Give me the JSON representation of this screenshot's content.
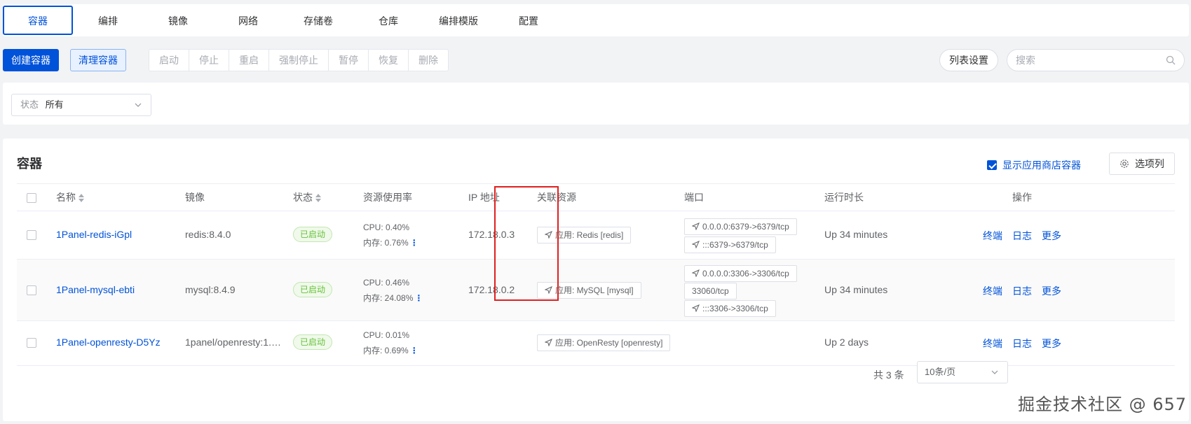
{
  "tabs": [
    "容器",
    "编排",
    "镜像",
    "网络",
    "存储卷",
    "仓库",
    "编排模版",
    "配置"
  ],
  "toolbar": {
    "create": "创建容器",
    "prune": "清理容器",
    "actions": [
      "启动",
      "停止",
      "重启",
      "强制停止",
      "暂停",
      "恢复",
      "删除"
    ],
    "list_settings": "列表设置",
    "search_placeholder": "搜索"
  },
  "filter": {
    "label": "状态",
    "value": "所有"
  },
  "main": {
    "title": "容器",
    "show_store": "显示应用商店容器",
    "columns_button": "选项列"
  },
  "columns": {
    "name": "名称",
    "image": "镜像",
    "status": "状态",
    "resource": "资源使用率",
    "ip": "IP 地址",
    "related": "关联资源",
    "ports": "端口",
    "uptime": "运行时长",
    "ops": "操作"
  },
  "rows": [
    {
      "name": "1Panel-redis-iGpl",
      "image": "redis:8.4.0",
      "status": "已启动",
      "cpu": "CPU: 0.40%",
      "mem": "内存: 0.76%",
      "ip": "172.18.0.3",
      "related": "应用: Redis [redis]",
      "ports": [
        "0.0.0.0:6379->6379/tcp",
        ":::6379->6379/tcp"
      ],
      "uptime": "Up 34 minutes",
      "ops": [
        "终端",
        "日志",
        "更多"
      ]
    },
    {
      "name": "1Panel-mysql-ebti",
      "image": "mysql:8.4.9",
      "status": "已启动",
      "cpu": "CPU: 0.46%",
      "mem": "内存: 24.08%",
      "ip": "172.18.0.2",
      "related": "应用: MySQL [mysql]",
      "ports": [
        "0.0.0.0:3306->3306/tcp",
        "33060/tcp",
        ":::3306->3306/tcp"
      ],
      "uptime": "Up 34 minutes",
      "ops": [
        "终端",
        "日志",
        "更多"
      ]
    },
    {
      "name": "1Panel-openresty-D5Yz",
      "image": "1panel/openresty:1.…",
      "status": "已启动",
      "cpu": "CPU: 0.01%",
      "mem": "内存: 0.69%",
      "ip": "",
      "related": "应用: OpenResty [openresty]",
      "ports": [],
      "uptime": "Up 2 days",
      "ops": [
        "终端",
        "日志",
        "更多"
      ]
    }
  ],
  "pagination": {
    "total": "共 3 条",
    "page_size": "10条/页"
  },
  "watermark": "掘金技术社区 @ 657",
  "colors": {
    "accent": "#0052d9",
    "success": "#67c23a",
    "highlight_box": "#e02020"
  }
}
